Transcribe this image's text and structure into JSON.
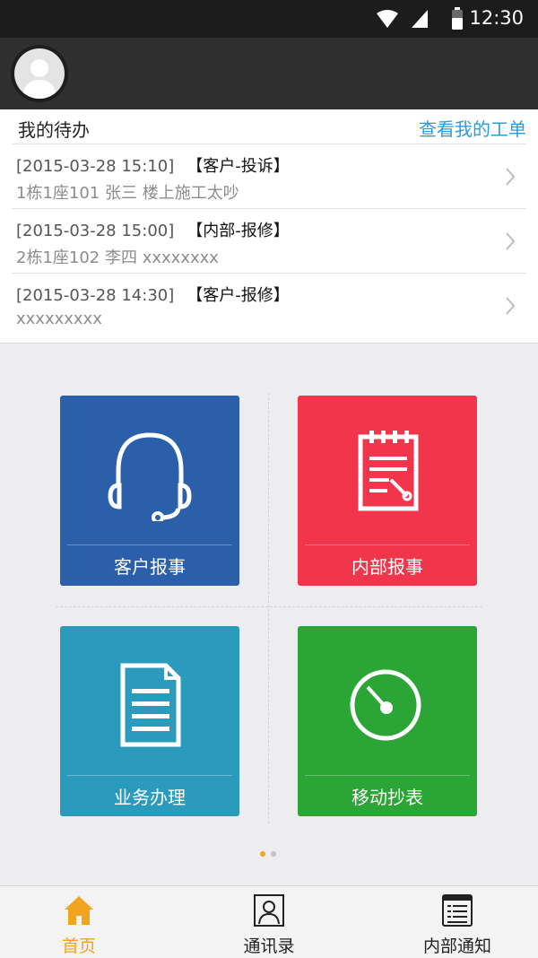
{
  "status_bar": {
    "time": "12:30"
  },
  "todo": {
    "title": "我的待办",
    "view_link": "查看我的工单",
    "items": [
      {
        "time": "[2015-03-28 15:10]",
        "tag": "【客户-投诉】",
        "detail": "1栋1座101 张三 楼上施工太吵"
      },
      {
        "time": "[2015-03-28 15:00]",
        "tag": "【内部-报修】",
        "detail": "2栋1座102 李四 xxxxxxxx"
      },
      {
        "time": "[2015-03-28 14:30]",
        "tag": "【客户-报修】",
        "detail": "xxxxxxxxx"
      }
    ]
  },
  "tiles": [
    {
      "label": "客户报事",
      "color": "#2b5fa9",
      "icon": "headset-icon"
    },
    {
      "label": "内部报事",
      "color": "#f1364b",
      "icon": "repair-notepad-icon"
    },
    {
      "label": "业务办理",
      "color": "#2a9bbd",
      "icon": "document-icon"
    },
    {
      "label": "移动抄表",
      "color": "#2ba536",
      "icon": "meter-gauge-icon"
    }
  ],
  "pager": {
    "active_color": "#f3a41f",
    "inactive_color": "#c4c4c4"
  },
  "tabs": [
    {
      "label": "首页",
      "icon": "home-icon",
      "active": true,
      "color": "#f3a41f"
    },
    {
      "label": "通讯录",
      "icon": "contacts-icon",
      "active": false
    },
    {
      "label": "内部通知",
      "icon": "notice-icon",
      "active": false
    }
  ]
}
